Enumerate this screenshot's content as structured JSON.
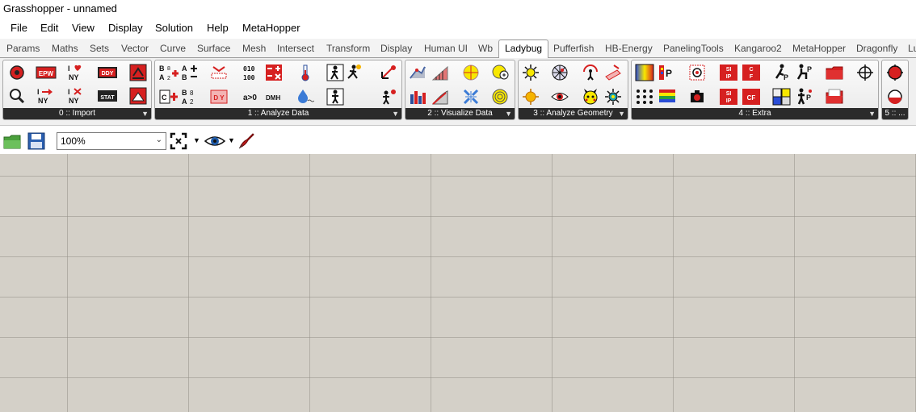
{
  "window": {
    "title": "Grasshopper - unnamed"
  },
  "menu": [
    "File",
    "Edit",
    "View",
    "Display",
    "Solution",
    "Help",
    "MetaHopper"
  ],
  "tabs": [
    "Params",
    "Maths",
    "Sets",
    "Vector",
    "Curve",
    "Surface",
    "Mesh",
    "Intersect",
    "Transform",
    "Display",
    "Human UI",
    "Wb",
    "Ladybug",
    "Pufferfish",
    "HB-Energy",
    "PanelingTools",
    "Kangaroo2",
    "MetaHopper",
    "Dragonfly",
    "Lu"
  ],
  "active_tab": "Ladybug",
  "ribbon_groups": [
    {
      "label": "0 :: Import",
      "icons": [
        "ladybug-import-icon",
        "epw-icon",
        "i-love-ny-icon",
        "ddy-icon",
        "download-weather-icon",
        "search-weather-icon",
        "i-to-ny-icon",
        "i-x-ny-icon",
        "stat-icon",
        "open-weather-icon"
      ]
    },
    {
      "label": "1 :: Analyze Data",
      "icons": [
        "b8-a2-icon",
        "a-plus-b-icon",
        "bit-convert-icon",
        "binary-icon",
        "calculator-icon",
        "thermometer-icon",
        "person-walk-icon",
        "person-run-icon",
        "radiation-icon",
        "c-plus-icon",
        "b8a2-icon",
        "d-y-icon",
        "a-greater-0-icon",
        "dmh-icon",
        "humidity-icon",
        "person-stand-icon",
        "sun-person-icon"
      ]
    },
    {
      "label": "2 :: Visualize Data",
      "icons": [
        "rose-icon",
        "bar-chart-icon",
        "sun-dome-icon",
        "sun-legend-icon",
        "bar-stack-icon",
        "slope-chart-icon",
        "compass-icon",
        "radial-icon"
      ]
    },
    {
      "label": "3 :: Analyze Geometry",
      "icons": [
        "sun-study-icon",
        "radiation-dome-icon",
        "view-arc-icon",
        "solar-window-icon",
        "sun-icon",
        "eye-icon",
        "pikachu-icon",
        "sun-rays-icon"
      ]
    },
    {
      "label": "4 :: Extra",
      "icons": [
        "color-legend-icon",
        "recolor-icon",
        "capture-icon",
        "si-ip-icon",
        "c-f-icon",
        "bike-icon",
        "sit-icon",
        "folder-icon",
        "crosshair-icon",
        "dots-icon",
        "palette-icon",
        "camera-icon",
        "si-ip-2-icon",
        "cf-icon",
        "tools-icon",
        "stand-icon",
        "open-folder-icon"
      ]
    },
    {
      "label": "5 :: ...",
      "icons": [
        "red-ball-icon",
        "red-ball-2-icon"
      ]
    }
  ],
  "canvas_toolbar": {
    "zoom": "100%"
  }
}
